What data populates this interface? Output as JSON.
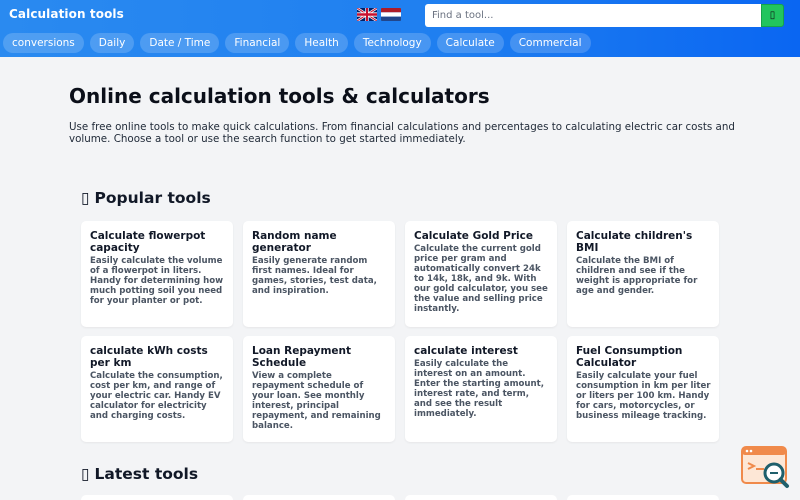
{
  "header": {
    "brand": "Calculation tools",
    "search_placeholder": "Find a tool...",
    "search_button_icon": "search-icon",
    "flags": [
      "uk-flag-icon",
      "nl-flag-icon"
    ]
  },
  "nav": {
    "items": [
      "conversions",
      "Daily",
      "Date / Time",
      "Financial",
      "Health",
      "Technology",
      "Calculate",
      "Commercial"
    ]
  },
  "main": {
    "title": "Online calculation tools & calculators",
    "intro": "Use free online tools to make quick calculations. From financial calculations and percentages to calculating electric car costs and volume. Choose a tool or use the search function to get started immediately.",
    "popular_heading": "Popular tools",
    "latest_heading": "Latest tools",
    "popular_tools": [
      {
        "title": "Calculate flowerpot capacity",
        "desc": "Easily calculate the volume of a flowerpot in liters. Handy for determining how much potting soil you need for your planter or pot."
      },
      {
        "title": "Random name generator",
        "desc": "Easily generate random first names. Ideal for games, stories, test data, and inspiration."
      },
      {
        "title": "Calculate Gold Price",
        "desc": "Calculate the current gold price per gram and automatically convert 24k to 14k, 18k, and 9k. With our gold calculator, you see the value and selling price instantly."
      },
      {
        "title": "Calculate children's BMI",
        "desc": "Calculate the BMI of children and see if the weight is appropriate for age and gender."
      },
      {
        "title": "calculate kWh costs per km",
        "desc": "Calculate the consumption, cost per km, and range of your electric car. Handy EV calculator for electricity and charging costs."
      },
      {
        "title": "Loan Repayment Schedule",
        "desc": "View a complete repayment schedule of your loan. See monthly interest, principal repayment, and remaining balance."
      },
      {
        "title": "calculate interest",
        "desc": "Easily calculate the interest on an amount. Enter the starting amount, interest rate, and term, and see the result immediately."
      },
      {
        "title": "Fuel Consumption Calculator",
        "desc": "Easily calculate your fuel consumption in km per liter or liters per 100 km. Handy for cars, motorcycles, or business mileage tracking."
      }
    ]
  },
  "colors": {
    "header_start": "#2a8af0",
    "header_end": "#0a66f2",
    "search_button": "#22c55e",
    "badge_orange": "#f08a4b",
    "badge_teal": "#1f5f6b"
  }
}
